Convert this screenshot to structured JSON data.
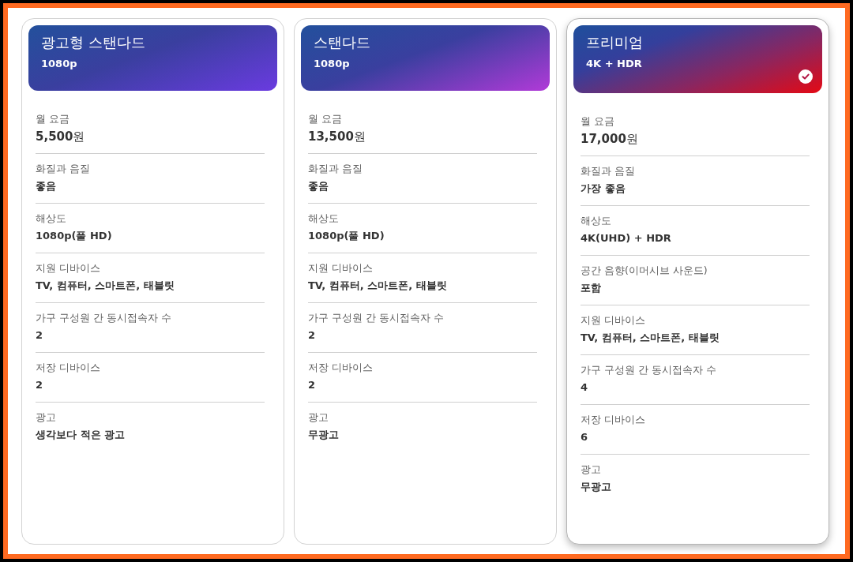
{
  "plans": [
    {
      "name": "광고형 스탠다드",
      "resolution": "1080p",
      "selected": false,
      "features": [
        {
          "label": "월 요금",
          "value": "**5,500**원"
        },
        {
          "label": "화질과 음질",
          "value": "좋음"
        },
        {
          "label": "해상도",
          "value": "1080p(풀 HD)"
        },
        {
          "label": "지원 디바이스",
          "value": "TV, 컴퓨터, 스마트폰, 태블릿"
        },
        {
          "label": "가구 구성원 간 동시접속자 수",
          "value": "2"
        },
        {
          "label": "저장 디바이스",
          "value": "2"
        },
        {
          "label": "광고",
          "value": "생각보다 적은 광고"
        }
      ]
    },
    {
      "name": "스탠다드",
      "resolution": "1080p",
      "selected": false,
      "features": [
        {
          "label": "월 요금",
          "value": "**13,500**원"
        },
        {
          "label": "화질과 음질",
          "value": "좋음"
        },
        {
          "label": "해상도",
          "value": "1080p(풀 HD)"
        },
        {
          "label": "지원 디바이스",
          "value": "TV, 컴퓨터, 스마트폰, 태블릿"
        },
        {
          "label": "가구 구성원 간 동시접속자 수",
          "value": "2"
        },
        {
          "label": "저장 디바이스",
          "value": "2"
        },
        {
          "label": "광고",
          "value": "무광고"
        }
      ]
    },
    {
      "name": "프리미엄",
      "resolution": "4K + HDR",
      "selected": true,
      "features": [
        {
          "label": "월 요금",
          "value": "**17,000**원"
        },
        {
          "label": "화질과 음질",
          "value": "가장 좋음"
        },
        {
          "label": "해상도",
          "value": "4K(UHD) + HDR"
        },
        {
          "label": "공간 음향(이머시브 사운드)",
          "value": "포함"
        },
        {
          "label": "지원 디바이스",
          "value": "TV, 컴퓨터, 스마트폰, 태블릿"
        },
        {
          "label": "가구 구성원 간 동시접속자 수",
          "value": "4"
        },
        {
          "label": "저장 디바이스",
          "value": "6"
        },
        {
          "label": "광고",
          "value": "무광고"
        }
      ]
    }
  ]
}
